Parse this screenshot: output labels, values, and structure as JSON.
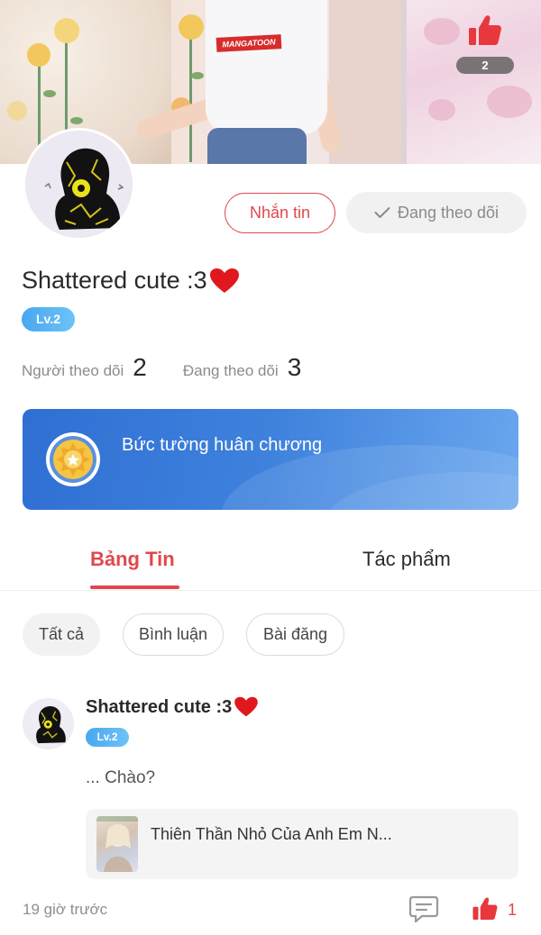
{
  "banner": {
    "like_count": "2",
    "shirt_text": "MANGATOON"
  },
  "profile": {
    "name": "Shattered cute :3",
    "level": "Lv.2",
    "message_button": "Nhắn tin",
    "following_button": "Đang theo dõi",
    "followers_label": "Người theo dõi",
    "followers_count": "2",
    "following_label": "Đang theo dõi",
    "following_count": "3"
  },
  "medal_wall": {
    "title": "Bức tường huân chương"
  },
  "tabs": [
    {
      "label": "Bảng Tin",
      "active": true
    },
    {
      "label": "Tác phẩm",
      "active": false
    }
  ],
  "filters": [
    {
      "label": "Tất cả",
      "selected": true
    },
    {
      "label": "Bình luận",
      "selected": false
    },
    {
      "label": "Bài đăng",
      "selected": false
    }
  ],
  "post": {
    "author": "Shattered cute :3",
    "level": "Lv.2",
    "text": "... Chào?",
    "work_title": "Thiên Thần Nhỏ Của Anh Em N...",
    "time": "19 giờ trước",
    "like_count": "1"
  },
  "colors": {
    "accent": "#e0484c",
    "badge_blue": "#4aa7f0",
    "medal_blue": "#2f6fd3"
  },
  "icons": [
    "thumbs-up-icon",
    "heart-icon",
    "check-icon",
    "medal-icon",
    "comment-icon",
    "avatar-image",
    "book-cover-image"
  ]
}
